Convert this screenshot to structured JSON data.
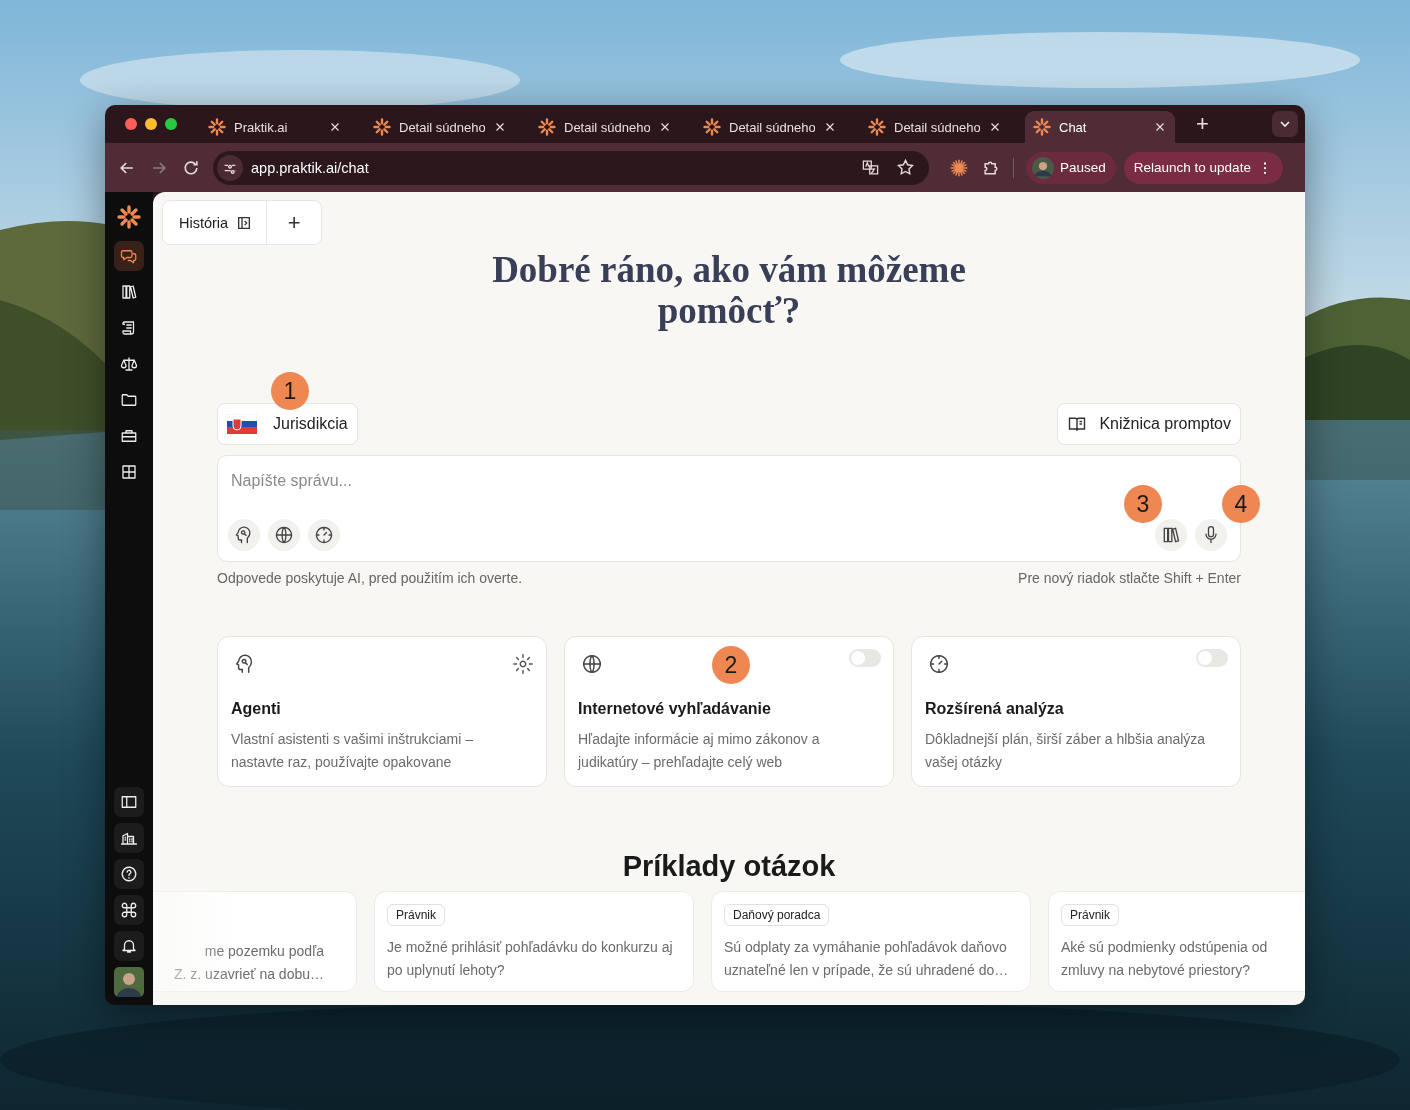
{
  "browser": {
    "tabs": [
      {
        "title": "Praktik.ai",
        "selected": false
      },
      {
        "title": "Detail súdneho",
        "selected": false
      },
      {
        "title": "Detail súdneho",
        "selected": false
      },
      {
        "title": "Detail súdneho",
        "selected": false
      },
      {
        "title": "Detail súdneho",
        "selected": false
      },
      {
        "title": "Chat",
        "selected": true
      }
    ],
    "new_tab": "+",
    "url": "app.praktik.ai/chat",
    "profile": "Paused",
    "update": "Relaunch to update"
  },
  "sidebar": {
    "top": [
      {
        "kind": "chat",
        "selected": true
      },
      {
        "kind": "books",
        "selected": false
      },
      {
        "kind": "scroll",
        "selected": false
      },
      {
        "kind": "scales",
        "selected": false
      },
      {
        "kind": "folder",
        "selected": false
      },
      {
        "kind": "briefcase",
        "selected": false
      },
      {
        "kind": "grid",
        "selected": false
      }
    ],
    "bottom": [
      {
        "kind": "panel"
      },
      {
        "kind": "building"
      },
      {
        "kind": "help"
      },
      {
        "kind": "command"
      },
      {
        "kind": "bell"
      }
    ]
  },
  "history": {
    "label": "História"
  },
  "new_chat": "+",
  "greeting": "Dobré ráno, ako vám môžeme pomôcť?",
  "jurisdiction": {
    "label": "Jurisdikcia",
    "marker": "1"
  },
  "prompt_library": {
    "label": "Knižnica promptov"
  },
  "composer": {
    "placeholder": "Napíšte správu...",
    "left_tools": [
      {
        "kind": "agent"
      },
      {
        "kind": "globe"
      },
      {
        "kind": "dial"
      }
    ],
    "right_tools": [
      {
        "kind": "books",
        "marker": "3"
      },
      {
        "kind": "mic",
        "marker": "4"
      }
    ]
  },
  "disclaimer": "Odpovede poskytuje AI, pred použitím ich overte.",
  "shortcut_hint": "Pre nový riadok stlačte Shift + Enter",
  "features": [
    {
      "kind": "settings",
      "title": "Agenti",
      "description": "Vlastní asistenti s vašimi inštrukciami –\nnastavte raz, používajte opakovane"
    },
    {
      "kind": "toggle",
      "on": false,
      "marker": "2",
      "title": "Internetové vyhľadávanie",
      "description": "Hľadajte informácie aj mimo zákonov a\njudikatúry – prehľadajte celý web"
    },
    {
      "kind": "toggle",
      "on": false,
      "title": "Rozšírená analýza",
      "description": "Dôkladnejší plán, širší záber a hlbšia analýza\nvašej otázky"
    }
  ],
  "examples_heading": "Príklady otázok",
  "examples": [
    {
      "text": "me pozemku podľa\nZ. z. uzavrieť na dobu…"
    },
    {
      "tag": "Právnik",
      "text": "Je možné prihlásiť pohľadávku do konkurzu aj\npo uplynutí lehoty?"
    },
    {
      "tag": "Daňový poradca",
      "text": "Sú odplaty za vymáhanie pohľadávok daňovo\nuznateľné len v prípade, že sú uhradené do…"
    },
    {
      "tag": "Právnik",
      "text": "Aké sú podmienky odstúpenia od\nzmluvy na nebytové priestory?"
    }
  ]
}
